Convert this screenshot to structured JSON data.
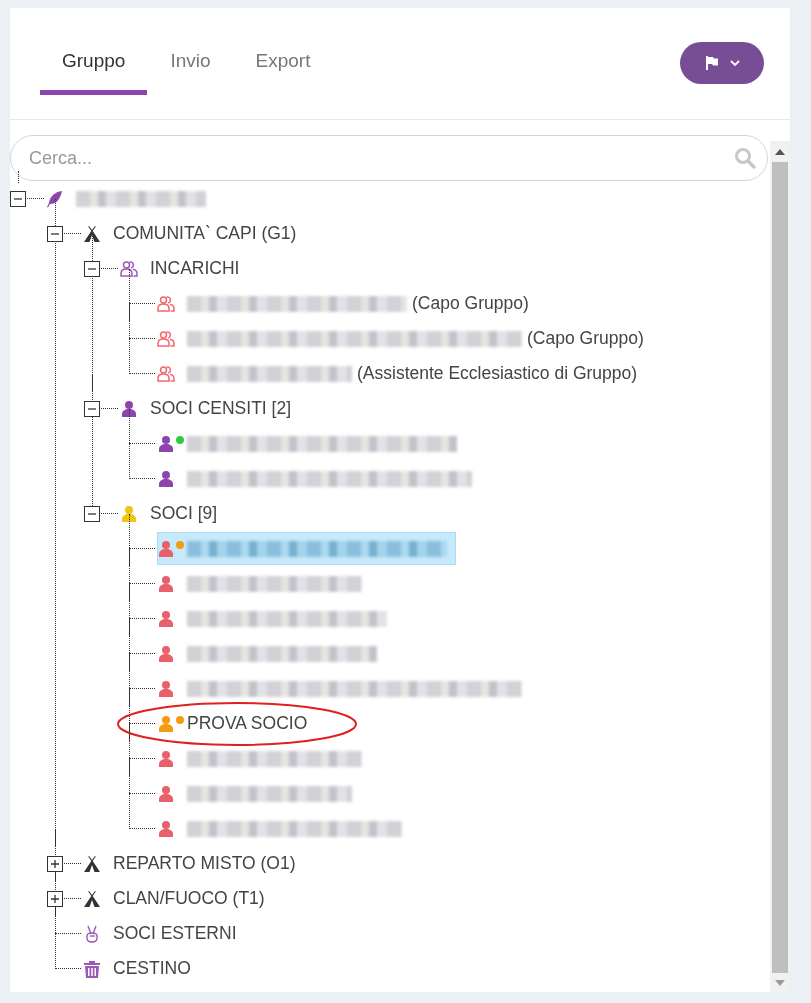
{
  "tabs": [
    {
      "label": "Gruppo",
      "selected": true
    },
    {
      "label": "Invio",
      "selected": false
    },
    {
      "label": "Export",
      "selected": false
    }
  ],
  "search": {
    "placeholder": "Cerca..."
  },
  "tree": [
    {
      "kind": "group",
      "redacted": true,
      "selected": false,
      "expanded": true,
      "children": [
        {
          "kind": "unit",
          "label": "COMUNITA` CAPI (G1)",
          "selected": false,
          "expanded": true,
          "children": [
            {
              "kind": "roles",
              "label": "INCARICHI",
              "selected": false,
              "expanded": true,
              "children": [
                {
                  "kind": "role",
                  "redacted": true,
                  "label": "(Capo Gruppo)",
                  "selected": false
                },
                {
                  "kind": "role",
                  "redacted": true,
                  "label": "(Capo Gruppo)",
                  "selected": false
                },
                {
                  "kind": "role",
                  "redacted": true,
                  "label": "(Assistente Ecclesiastico di Gruppo)",
                  "selected": false
                }
              ]
            },
            {
              "kind": "census",
              "label": "SOCI CENSITI [2]",
              "selected": false,
              "expanded": true,
              "children": [
                {
                  "kind": "censused",
                  "color": "#2ecc40",
                  "redacted": true,
                  "selected": false
                },
                {
                  "kind": "censused",
                  "redacted": true,
                  "selected": false
                }
              ]
            },
            {
              "kind": "members",
              "label": "SOCI [9]",
              "selected": false,
              "expanded": true,
              "children": [
                {
                  "kind": "member",
                  "color": "#f39c12",
                  "redacted": true,
                  "selected": true
                },
                {
                  "kind": "member",
                  "redacted": true,
                  "selected": false
                },
                {
                  "kind": "member",
                  "redacted": true,
                  "selected": false
                },
                {
                  "kind": "member",
                  "redacted": true,
                  "selected": false
                },
                {
                  "kind": "member",
                  "redacted": true,
                  "selected": false
                },
                {
                  "kind": "new_member",
                  "color": "#f39c12",
                  "label": "PROVA SOCIO",
                  "circled": true,
                  "selected": false
                },
                {
                  "kind": "member",
                  "redacted": true,
                  "selected": false
                },
                {
                  "kind": "member",
                  "redacted": true,
                  "selected": false
                },
                {
                  "kind": "member",
                  "redacted": true,
                  "selected": false
                }
              ]
            }
          ]
        },
        {
          "kind": "unit",
          "label": "REPARTO MISTO (O1)",
          "selected": false,
          "expanded": false
        },
        {
          "kind": "unit",
          "label": "CLAN/FUOCO (T1)",
          "selected": false,
          "expanded": false
        },
        {
          "kind": "external",
          "label": "SOCI ESTERNI",
          "selected": false
        },
        {
          "kind": "trash",
          "label": "CESTINO",
          "selected": false
        }
      ]
    }
  ]
}
